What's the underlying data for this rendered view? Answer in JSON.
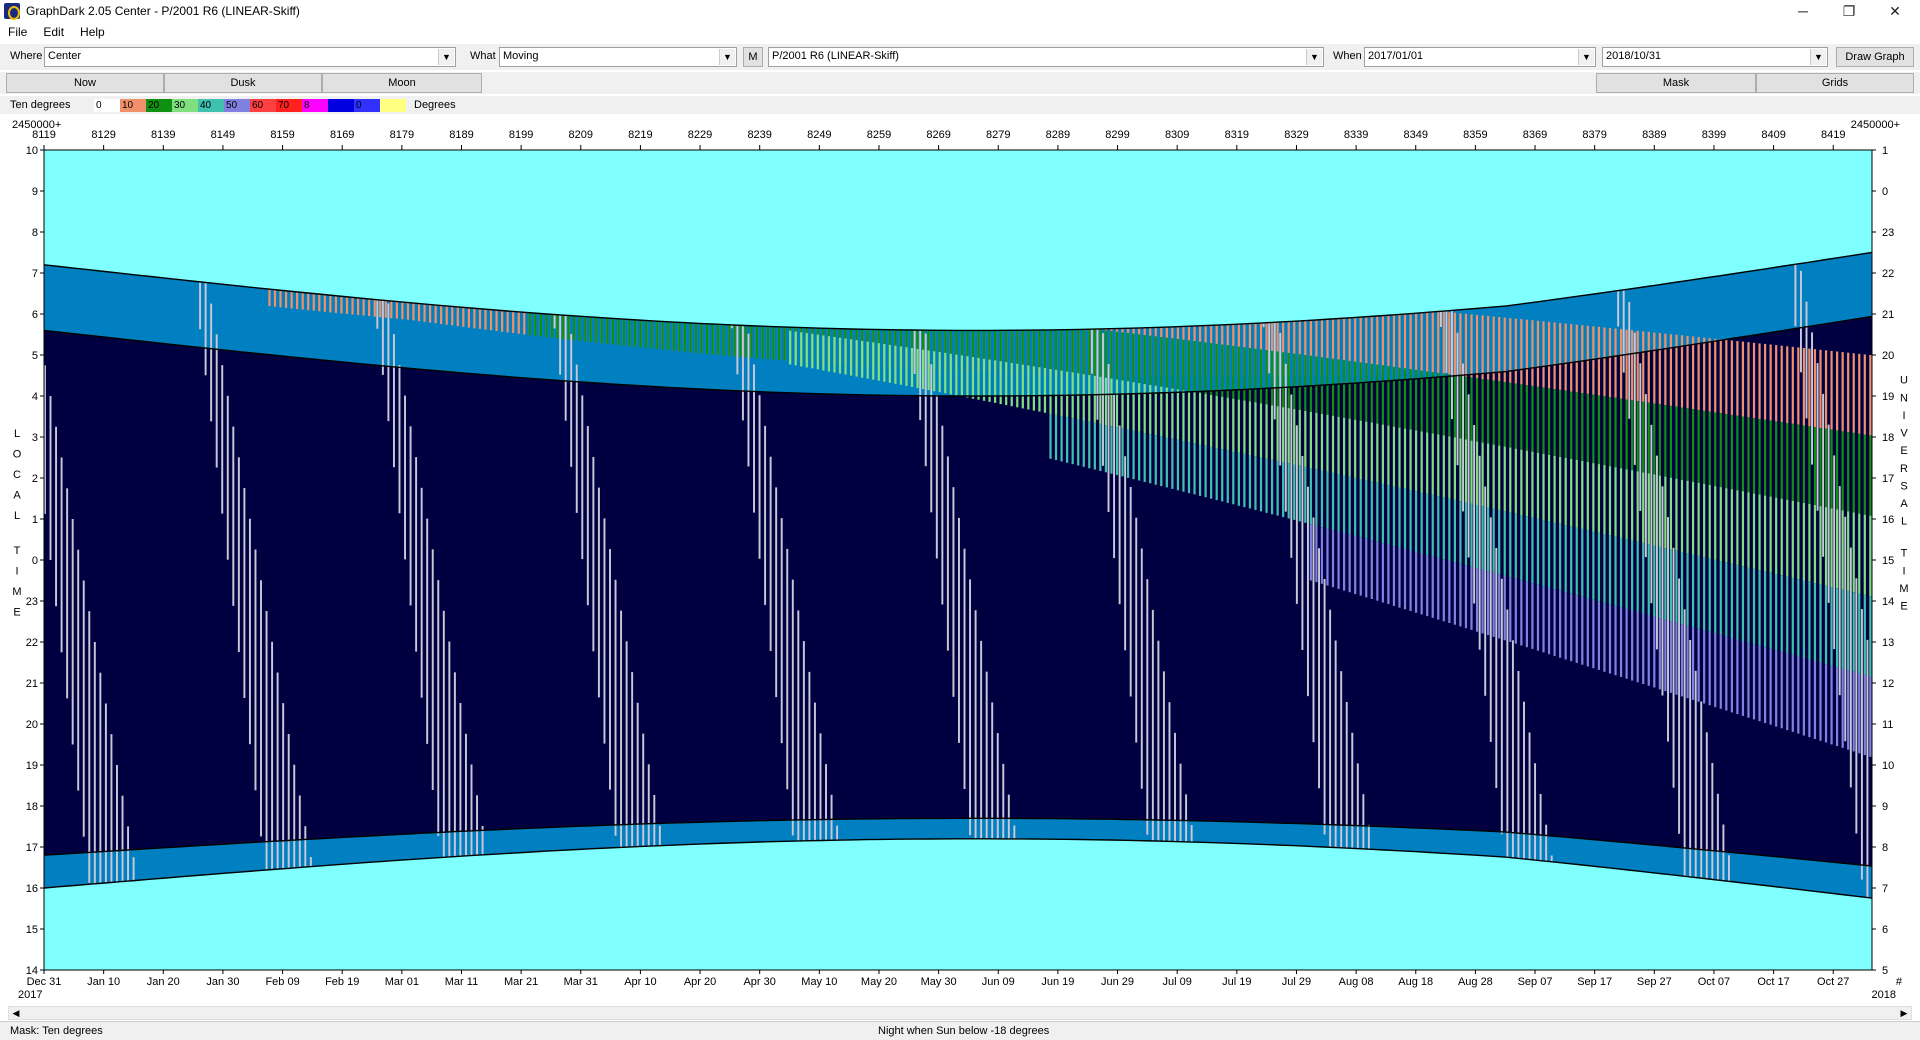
{
  "window": {
    "title": "GraphDark 2.05  Center  -  P/2001 R6 (LINEAR-Skiff)",
    "minimize": "─",
    "maximize": "❐",
    "close": "✕"
  },
  "menu": [
    "File",
    "Edit",
    "Help"
  ],
  "toolbar": {
    "where_label": "Where",
    "where_value": "Center",
    "what_label": "What",
    "what_value": "Moving",
    "m_button": "M",
    "object_value": "P/2001 R6 (LINEAR-Skiff)",
    "when_label": "When",
    "start_date": "2017/01/01",
    "end_date": "2018/10/31",
    "draw_button": "Draw Graph"
  },
  "buttons_row": {
    "now": "Now",
    "dusk": "Dusk",
    "moon": "Moon",
    "mask": "Mask",
    "grids": "Grids"
  },
  "legend": {
    "title": "Ten degrees",
    "end_label": "Degrees",
    "items": [
      {
        "label": "0",
        "color": "#ffffff"
      },
      {
        "label": "10",
        "color": "#f0906a"
      },
      {
        "label": "20",
        "color": "#109010"
      },
      {
        "label": "30",
        "color": "#80e080"
      },
      {
        "label": "40",
        "color": "#40c0b0"
      },
      {
        "label": "50",
        "color": "#8080e0"
      },
      {
        "label": "60",
        "color": "#ff4040"
      },
      {
        "label": "70",
        "color": "#ff2020"
      },
      {
        "label": "8",
        "color": "#ff00ff"
      },
      {
        "label": "",
        "color": "#0000e0"
      },
      {
        "label": "0",
        "color": "#3030ff"
      },
      {
        "label": "",
        "color": "#ffff80"
      }
    ]
  },
  "chart_data": {
    "type": "heatmap",
    "jd_prefix_left": "2450000+",
    "jd_prefix_right": "2450000+",
    "jd_ticks": [
      "8119",
      "8129",
      "8139",
      "8149",
      "8159",
      "8169",
      "8179",
      "8189",
      "8199",
      "8209",
      "8219",
      "8229",
      "8239",
      "8249",
      "8259",
      "8269",
      "8279",
      "8289",
      "8299",
      "8309",
      "8319",
      "8329",
      "8339",
      "8349",
      "8359",
      "8369",
      "8379",
      "8389",
      "8399",
      "8409",
      "8419"
    ],
    "date_ticks": [
      "Dec 31",
      "Jan 10",
      "Jan 20",
      "Jan 30",
      "Feb 09",
      "Feb 19",
      "Mar 01",
      "Mar 11",
      "Mar 21",
      "Mar 31",
      "Apr 10",
      "Apr 20",
      "Apr 30",
      "May 10",
      "May 20",
      "May 30",
      "Jun 09",
      "Jun 19",
      "Jun 29",
      "Jul 09",
      "Jul 19",
      "Jul 29",
      "Aug 08",
      "Aug 18",
      "Aug 28",
      "Sep 07",
      "Sep 17",
      "Sep 27",
      "Oct 07",
      "Oct 17",
      "Oct 27"
    ],
    "year_left": "2017",
    "year_right": "2018",
    "end_mark": "#",
    "left_axis_ticks": [
      "10",
      "9",
      "8",
      "7",
      "6",
      "5",
      "4",
      "3",
      "2",
      "1",
      "0",
      "23",
      "22",
      "21",
      "20",
      "19",
      "18",
      "17",
      "16",
      "15",
      "14"
    ],
    "right_axis_ticks": [
      "1",
      "0",
      "23",
      "22",
      "21",
      "20",
      "19",
      "18",
      "17",
      "16",
      "15",
      "14",
      "13",
      "12",
      "11",
      "10",
      "9",
      "8",
      "7",
      "6",
      "5"
    ],
    "left_axis_label": "LOCAL TIME",
    "right_axis_label": "UNIVERSAL TIME",
    "colors": {
      "day": "#80ffff",
      "twilight": "#0080c0",
      "night": "#000040",
      "moon": "#c8c8d8",
      "alt10": "#f0906a",
      "alt20": "#109010",
      "alt30": "#80e080",
      "alt40": "#40c0b0",
      "alt50": "#8080e0"
    }
  },
  "status": {
    "left": "Mask:  Ten degrees",
    "center": "Night when Sun below -18 degrees"
  }
}
